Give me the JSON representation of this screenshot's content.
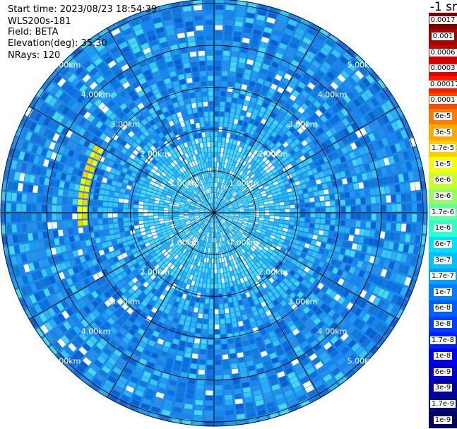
{
  "info": {
    "start_time": "Start time: 2023/08/23 18:54:39",
    "instrument": "WLS200s-181",
    "field": "Field: BETA",
    "elevation": "Elevation(deg): 35.30",
    "nrays": "NRays: 120"
  },
  "colorbar": {
    "unit_label": "-1 sr",
    "labels": [
      "0.0017",
      "0.001",
      "0.0006",
      "0.0003",
      "0.00017",
      "0.0001",
      "6e-5",
      "3e-5",
      "1.7e-5",
      "1e-5",
      "6e-6",
      "3e-6",
      "1.7e-6",
      "1e-6",
      "6e-7",
      "3e-7",
      "1.7e-7",
      "1e-7",
      "6e-8",
      "3e-8",
      "1.7e-8",
      "1e-8",
      "6e-9",
      "3e-9",
      "1.7e-9",
      "1e-9"
    ],
    "colors": [
      "#7f0000",
      "#a30000",
      "#c40000",
      "#e00000",
      "#ff1a00",
      "#ff4a00",
      "#ff7a00",
      "#ffa800",
      "#ffd000",
      "#f5ff00",
      "#c8ff30",
      "#96ff60",
      "#60ffa0",
      "#30ffd0",
      "#00e0ff",
      "#00c0ff",
      "#00a0ff",
      "#0080ff",
      "#0060ff",
      "#0040ff",
      "#0020ff",
      "#0000f0",
      "#0000c8",
      "#0000a0",
      "#000080",
      "#000060"
    ]
  },
  "chart_data": {
    "type": "heatmap",
    "subtype": "polar-ppi",
    "field": "BETA",
    "elevation_deg": 35.3,
    "n_rays": 120,
    "range_ring_labels": [
      "1.00km",
      "2.00km",
      "3.00km",
      "4.00km",
      "5.00km"
    ],
    "range_rings_km": [
      1,
      2,
      3,
      4,
      5
    ],
    "max_range_km": 5.0,
    "scale": "log",
    "value_range": [
      1e-09,
      0.0017
    ],
    "dominant_level": "1e-7 to 1e-8",
    "feature": {
      "label": "1e-5",
      "azimuth_deg": [
        265,
        300
      ],
      "range_km": [
        3.0,
        3.3
      ]
    }
  }
}
